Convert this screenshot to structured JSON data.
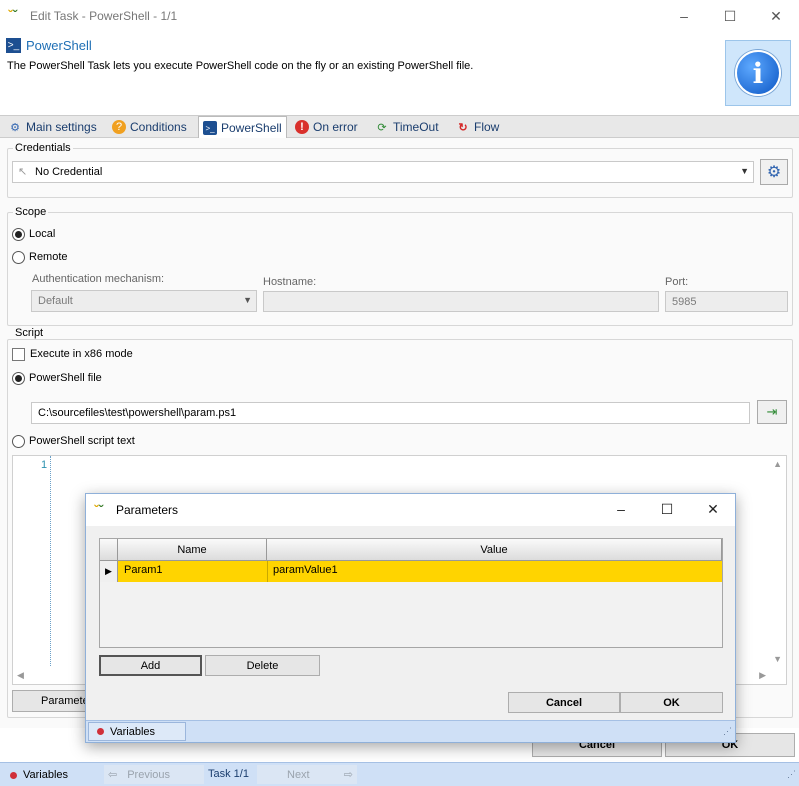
{
  "window": {
    "title": "Edit Task - PowerShell - 1/1",
    "minimize_icon": "–",
    "maximize_icon": "☐",
    "close_icon": "✕"
  },
  "header": {
    "title": "PowerShell",
    "description": "The PowerShell Task lets you execute PowerShell code on the fly or an existing PowerShell file."
  },
  "tabs": [
    {
      "label": "Main settings",
      "icon": "gear-icon",
      "active": false
    },
    {
      "label": "Conditions",
      "icon": "condition-icon",
      "active": false
    },
    {
      "label": "PowerShell",
      "icon": "powershell-icon",
      "active": true
    },
    {
      "label": "On error",
      "icon": "error-icon",
      "active": false
    },
    {
      "label": "TimeOut",
      "icon": "timeout-icon",
      "active": false
    },
    {
      "label": "Flow",
      "icon": "flow-icon",
      "active": false
    }
  ],
  "credentials": {
    "group_label": "Credentials",
    "value": "No Credential"
  },
  "scope": {
    "group_label": "Scope",
    "local_label": "Local",
    "remote_label": "Remote",
    "selected": "Local",
    "auth_label": "Authentication mechanism:",
    "auth_value": "Default",
    "hostname_label": "Hostname:",
    "hostname_value": "",
    "port_label": "Port:",
    "port_value": "5985"
  },
  "script": {
    "group_label": "Script",
    "x86_label": "Execute in x86 mode",
    "x86_checked": false,
    "file_label": "PowerShell file",
    "file_path": "C:\\sourcefiles\\test\\powershell\\param.ps1",
    "text_label": "PowerShell script text",
    "line_number": "1",
    "params_button": "Paramete"
  },
  "dialog": {
    "title": "Parameters",
    "columns": [
      "Name",
      "Value"
    ],
    "rows": [
      {
        "name": "Param1",
        "value": "paramValue1"
      }
    ],
    "add_label": "Add",
    "delete_label": "Delete",
    "cancel_label": "Cancel",
    "ok_label": "OK",
    "variables_label": "Variables"
  },
  "footer": {
    "cancel_label": "Cancel",
    "ok_label": "OK"
  },
  "statusbar": {
    "variables_label": "Variables",
    "previous_label": "Previous",
    "task_label": "Task 1/1",
    "next_label": "Next"
  },
  "colors": {
    "accent_blue": "#1f6fb5",
    "selected_row": "#ffd400",
    "statusbar": "#cfe0f6"
  }
}
